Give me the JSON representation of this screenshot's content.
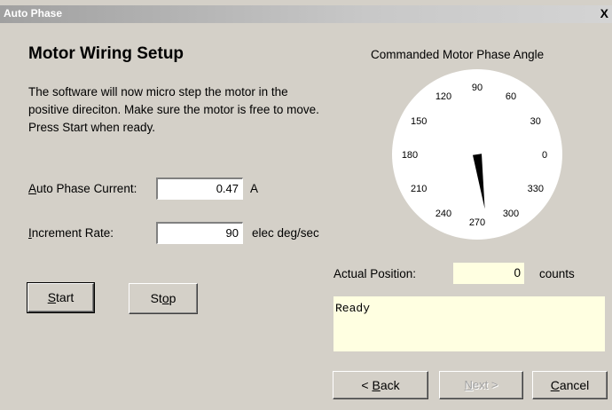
{
  "window": {
    "title": "Auto Phase",
    "close_glyph": "X"
  },
  "heading": "Motor Wiring Setup",
  "description": "The software will now micro step the motor in the positive direciton.  Make sure the motor is free to move.  Press Start when ready.",
  "current": {
    "label_key": "A",
    "label_rest": "uto Phase Current:",
    "value": "0.47",
    "unit": "A"
  },
  "rate": {
    "label_key": "I",
    "label_rest": "ncrement Rate:",
    "value": "90",
    "unit": "elec deg/sec"
  },
  "buttons": {
    "start_key": "S",
    "start_rest": "tart",
    "stop_pre": "St",
    "stop_key": "o",
    "stop_post": "p",
    "back_pre": "< ",
    "back_key": "B",
    "back_rest": "ack",
    "next_key": "N",
    "next_rest": "ext >",
    "cancel_key": "C",
    "cancel_rest": "ancel"
  },
  "dial": {
    "title": "Commanded Motor Phase Angle",
    "angle_deg": 270,
    "tick_labels": [
      "0",
      "30",
      "60",
      "90",
      "120",
      "150",
      "180",
      "210",
      "240",
      "270",
      "300",
      "330"
    ]
  },
  "position": {
    "label": "Actual Position:",
    "value": "0",
    "unit": "counts"
  },
  "status_text": "Ready"
}
